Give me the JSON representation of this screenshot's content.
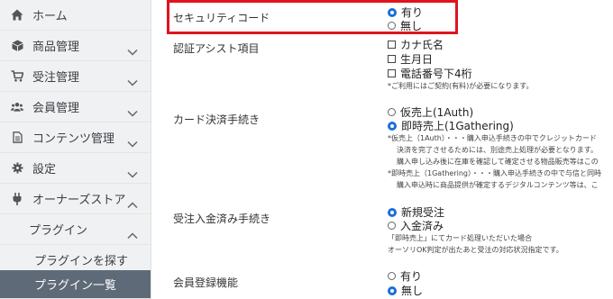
{
  "sidebar": {
    "items": [
      {
        "label": "ホーム",
        "icon": "home-icon"
      },
      {
        "label": "商品管理",
        "icon": "cube-icon"
      },
      {
        "label": "受注管理",
        "icon": "cart-icon"
      },
      {
        "label": "会員管理",
        "icon": "users-icon"
      },
      {
        "label": "コンテンツ管理",
        "icon": "file-icon"
      },
      {
        "label": "設定",
        "icon": "gear-icon"
      },
      {
        "label": "オーナーズストア",
        "icon": "plug-icon"
      }
    ],
    "sub": {
      "plugin": "プラグイン",
      "plugin_search": "プラグインを探す",
      "plugin_list": "プラグイン一覧"
    }
  },
  "settings": {
    "security_code": {
      "label": "セキュリティコード",
      "options": [
        "有り",
        "無し"
      ],
      "selected": "有り"
    },
    "auth_assist": {
      "label": "認証アシスト項目",
      "options": [
        "カナ氏名",
        "生月日",
        "電話番号下4桁"
      ],
      "note": "*ご利用にはご契約(有料)が必要になります。"
    },
    "card_procedure": {
      "label": "カード決済手続き",
      "options": [
        "仮売上(1Auth)",
        "即時売上(1Gathering)"
      ],
      "selected": "即時売上(1Gathering)",
      "notes": [
        "*仮売上（1Auth）・・・購入申込手続きの中でクレジットカード",
        "決済を完了させるためには、別途売上処理が必要となります。",
        "購入申し込み後に在庫を確認して確定させる物品販売等はこの",
        "*即時売上（1Gathering）・・・購入申込手続きの中で与信と同時",
        "購入申込時に商品提供が確定するデジタルコンテンツ等は、こ"
      ]
    },
    "receipt_procedure": {
      "label": "受注入金済み手続き",
      "options": [
        "新規受注",
        "入金済み"
      ],
      "selected": "新規受注",
      "notes": [
        "「即時売上」にてカード処理いただいた場合",
        "オーソリOK判定が出たあと受注の対応状況指定です。"
      ]
    },
    "member_registration": {
      "label": "会員登録機能",
      "options": [
        "有り",
        "無し"
      ],
      "selected": "無し"
    }
  },
  "colors": {
    "accent": "#1a6fd8",
    "highlight": "#e0141e",
    "sidebar_active": "#5e6a77",
    "sidebar_bg": "#f0f1f2"
  }
}
